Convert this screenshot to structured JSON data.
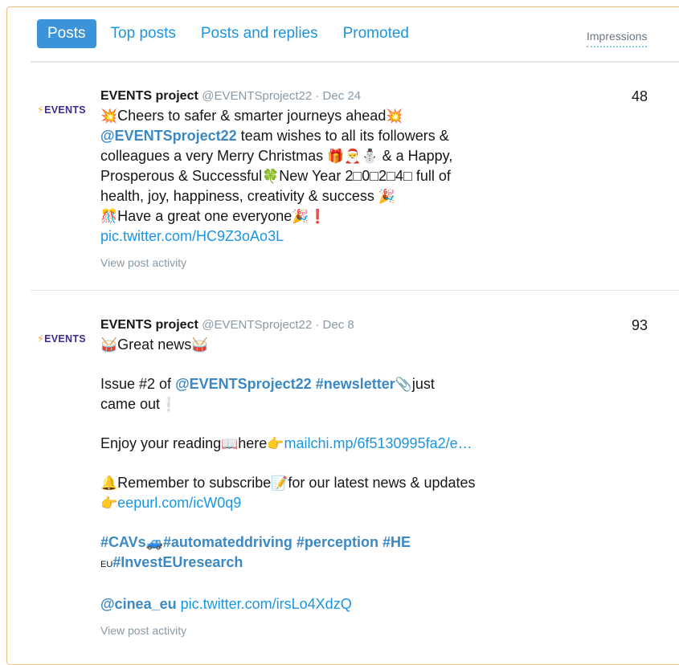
{
  "tabs": [
    "Posts",
    "Top posts",
    "Posts and replies",
    "Promoted"
  ],
  "column_header": "Impressions",
  "posts": [
    {
      "avatar_text": "EVENTS",
      "author": "EVENTS project",
      "handle": "@EVENTSproject22 · Dec 24",
      "impressions": "48",
      "l1": "Cheers to safer & smarter journeys ahead",
      "mention": "@EVENTSproject22",
      "l2b": " team wishes to all its followers &",
      "l3": "colleagues a very Merry Christmas",
      "l3b": " & a Happy,",
      "l4": "Prosperous & Successful",
      "l4b": "New Year 2□0□2□4□ full of",
      "l5": "health, joy, happiness, creativity & success",
      "l6": "Have a great one everyone",
      "pic": "pic.twitter.com/HC9Z3oAo3L",
      "activity": "View post activity"
    },
    {
      "avatar_text": "EVENTS",
      "author": "EVENTS project",
      "handle": "@EVENTSproject22 · Dec 8",
      "impressions": "93",
      "l1": "Great news",
      "l2a": "Issue #2 of ",
      "mention": "@EVENTSproject22",
      "hashtag1": "#newsletter",
      "l2b": "just",
      "l3": "came out",
      "l4a": "Enjoy your reading",
      "l4b": "here",
      "link1": "mailchi.mp/6f5130995fa2/e…",
      "l5a": "Remember to subscribe",
      "l5b": "for our latest news & updates",
      "link2": "eepurl.com/icW0q9",
      "hashtag2": "#CAVs",
      "hashtag3": "#automateddriving",
      "hashtag4": "#perception",
      "hashtag5": "#HE",
      "eu_small": "EU",
      "hashtag6": "#InvestEUresearch",
      "mention2": "@cinea_eu",
      "pic": "pic.twitter.com/irsLo4XdzQ",
      "activity": "View post activity"
    }
  ]
}
